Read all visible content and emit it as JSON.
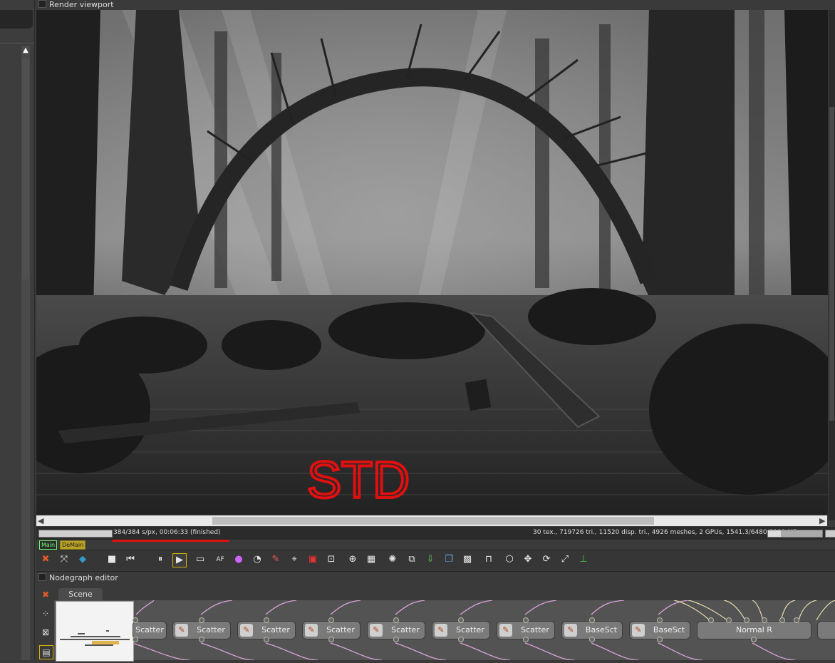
{
  "render_viewport": {
    "title": "Render viewport",
    "overlay_text": "STD"
  },
  "status": {
    "progress_fraction": 1.0,
    "render_info": "384/384 s/px, 00:06:33 (finished)",
    "scene_stats": "30 tex., 719726 tri., 11520 disp. tri., 4926 meshes, 2 GPUs, 1541.3/6480/8192 MB",
    "memory_fraction": 0.24,
    "layers": [
      "Main",
      "DeMain"
    ]
  },
  "toolbar": {
    "icons": [
      "cancel-render-icon",
      "recenter-icon",
      "color-cube-icon",
      "stop-icon",
      "restart-icon",
      "pause-icon",
      "play-icon",
      "display-icon",
      "af-icon",
      "color-wheel-icon",
      "sphere-icon",
      "paint-icon",
      "object-picker-icon",
      "material-picker-icon",
      "camera-target-icon",
      "zoom-icon",
      "grid-icon",
      "spinner-icon",
      "copy-icon",
      "load-icon",
      "layers-icon",
      "checker-icon",
      "lock-icon",
      "box-icon",
      "move-icon",
      "rotate-icon",
      "fit-icon",
      "axes-icon"
    ],
    "af_label": "AF"
  },
  "nodegraph": {
    "title": "Nodegraph editor",
    "tab": "Scene",
    "nodes": [
      "Scatter",
      "Scatter",
      "Scatter",
      "Scatter",
      "Scatter",
      "Scatter",
      "Scatter",
      "BaseSct",
      "BaseSct",
      "Normal R"
    ]
  },
  "colors": {
    "accent_underline": "#e01010",
    "tag_main": "#6cff6c",
    "tag_demain": "#b9a225",
    "node_wire": "#d9a2d9",
    "selected_outline": "#d9b400"
  }
}
